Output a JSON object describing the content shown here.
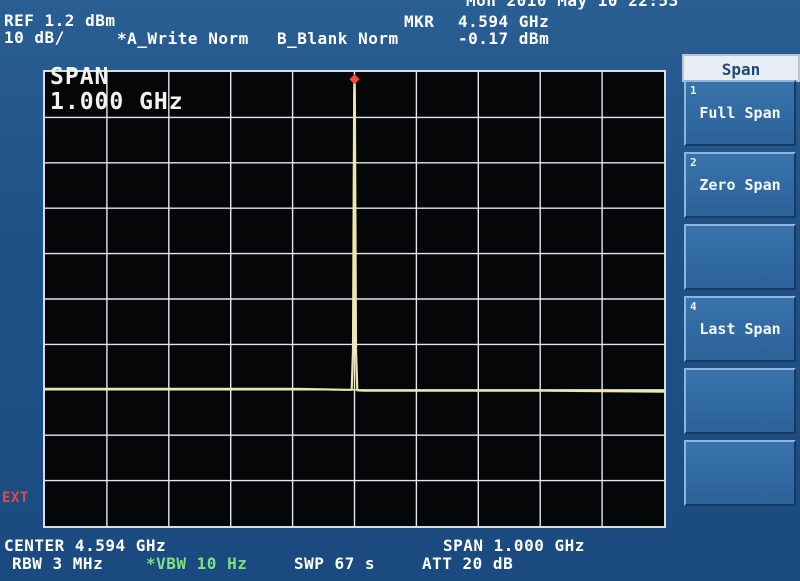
{
  "header": {
    "top_clock": "Mon 2010 May 10 22:53",
    "ref_level": "REF 1.2 dBm",
    "scale": "10 dB/",
    "trace_a": "*A_Write Norm",
    "trace_b": "B_Blank Norm",
    "marker_label": "MKR",
    "marker_freq": "4.594 GHz",
    "marker_level": "-0.17 dBm"
  },
  "display": {
    "span_label": "SPAN",
    "span_value": "1.000 GHz",
    "ext_indicator": "EXT",
    "colors": {
      "trace": "#eee8a8",
      "grid": "#e4e8ec",
      "marker": "#ff4a3a",
      "background": "#050608"
    }
  },
  "footer": {
    "center": "CENTER 4.594 GHz",
    "span": "SPAN 1.000 GHz",
    "rbw": "RBW 3 MHz",
    "vbw": "*VBW 10 Hz",
    "sweep": "SWP 67 s",
    "attenuation": "ATT 20 dB"
  },
  "softkeys": {
    "title": "Span",
    "keys": [
      {
        "num": "1",
        "label": "Full Span"
      },
      {
        "num": "2",
        "label": "Zero Span"
      },
      {
        "num": "4",
        "label": "Last Span"
      }
    ]
  },
  "chart_data": {
    "type": "line",
    "title": "",
    "xlabel": "",
    "ylabel": "",
    "x_unit": "GHz",
    "y_unit": "dBm",
    "xlim": [
      4.094,
      5.094
    ],
    "ylim": [
      -98.8,
      1.2
    ],
    "grid": true,
    "series": [
      {
        "x": [
          4.094,
          4.5,
          4.58,
          4.5895,
          4.5915,
          4.5935,
          4.594,
          4.5945,
          4.5965,
          4.5985,
          4.61,
          4.7,
          4.8,
          4.9,
          5.094
        ],
        "values": [
          -68.6,
          -68.6,
          -68.8,
          -68.8,
          -60.0,
          -3.0,
          -0.17,
          -3.0,
          -60.0,
          -68.9,
          -69.0,
          -69.0,
          -69.0,
          -69.0,
          -69.2
        ]
      }
    ],
    "markers": [
      {
        "x": 4.594,
        "y": -0.17
      }
    ]
  }
}
